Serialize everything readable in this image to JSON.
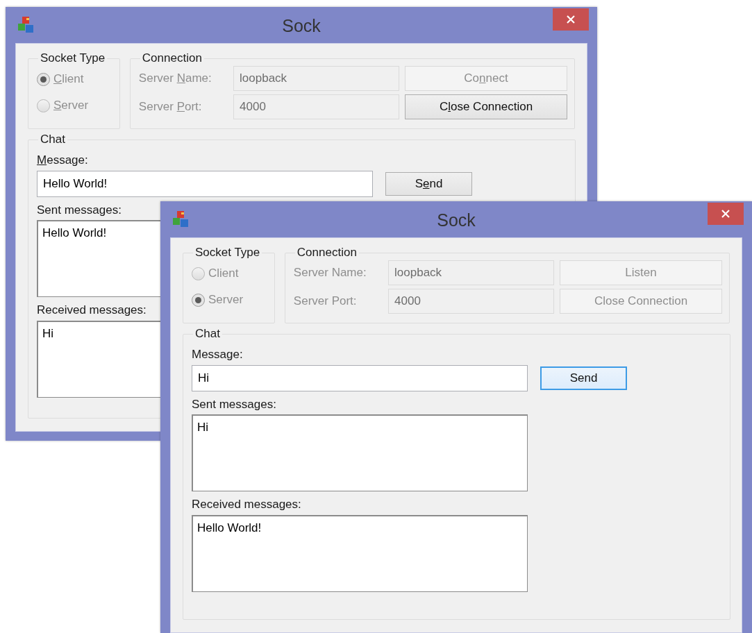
{
  "windows": [
    {
      "title": "Sock",
      "socket_type": {
        "title": "Socket Type",
        "disabled": true,
        "options": [
          {
            "label": {
              "key": "C",
              "post": "lient"
            },
            "selected": true
          },
          {
            "label": {
              "key": "S",
              "post": "erver"
            },
            "selected": false
          }
        ]
      },
      "connection": {
        "title": "Connection",
        "fields": [
          {
            "label": {
              "pre": "Server ",
              "key": "N",
              "post": "ame:"
            },
            "value": "loopback",
            "disabled": true
          },
          {
            "label": {
              "pre": "Server ",
              "key": "P",
              "post": "ort:"
            },
            "value": "4000",
            "disabled": true
          }
        ],
        "buttons": [
          {
            "label": {
              "pre": "Co",
              "key": "n",
              "post": "nect"
            },
            "disabled": true
          },
          {
            "label": {
              "pre": "C",
              "key": "l",
              "post": "ose Connection"
            },
            "disabled": false
          }
        ]
      },
      "chat": {
        "title": "Chat",
        "message_label": {
          "key": "M",
          "post": "essage:"
        },
        "message": "Hello World!",
        "send": {
          "label": {
            "pre": "S",
            "key": "e",
            "post": "nd"
          },
          "disabled": false,
          "focused": false
        },
        "sent_label": "Sent messages:",
        "sent": "Hello World!",
        "received_label": "Received messages:",
        "received": "Hi"
      }
    },
    {
      "title": "Sock",
      "socket_type": {
        "title": "Socket Type",
        "disabled": true,
        "options": [
          {
            "label": "Client",
            "selected": false
          },
          {
            "label": "Server",
            "selected": true
          }
        ]
      },
      "connection": {
        "title": "Connection",
        "fields": [
          {
            "label": "Server Name:",
            "value": "loopback",
            "disabled": true
          },
          {
            "label": "Server Port:",
            "value": "4000",
            "disabled": true
          }
        ],
        "buttons": [
          {
            "label": "Listen",
            "disabled": true
          },
          {
            "label": "Close Connection",
            "disabled": true
          }
        ]
      },
      "chat": {
        "title": "Chat",
        "message_label": "Message:",
        "message": "Hi",
        "send": {
          "label": "Send",
          "disabled": false,
          "focused": true
        },
        "sent_label": "Sent messages:",
        "sent": "Hi",
        "received_label": "Received messages:",
        "received": "Hello World!"
      }
    }
  ]
}
